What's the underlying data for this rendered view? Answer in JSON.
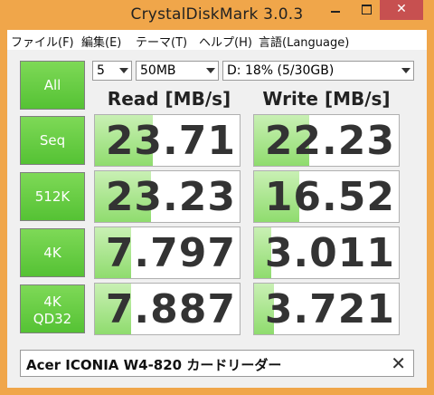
{
  "window": {
    "title": "CrystalDiskMark 3.0.3",
    "close_glyph": "✕"
  },
  "menu": [
    "ファイル(F)",
    "編集(E)",
    "テーマ(T)",
    "ヘルプ(H)",
    "言語(Language)"
  ],
  "controls": {
    "count": "5",
    "size": "50MB",
    "drive": "D: 18% (5/30GB)"
  },
  "headers": {
    "read": "Read [MB/s]",
    "write": "Write [MB/s]"
  },
  "buttons": {
    "all": "All",
    "seq": "Seq",
    "k512": "512K",
    "k4": "4K",
    "k4qd32_line1": "4K",
    "k4qd32_line2": "QD32"
  },
  "results": {
    "seq": {
      "read": "23.71",
      "write": "22.23",
      "read_bar": 0.4,
      "write_bar": 0.38
    },
    "k512": {
      "read": "23.23",
      "write": "16.52",
      "read_bar": 0.39,
      "write_bar": 0.31
    },
    "k4": {
      "read": "7.797",
      "write": "3.011",
      "read_bar": 0.25,
      "write_bar": 0.12
    },
    "k4qd32": {
      "read": "7.887",
      "write": "3.721",
      "read_bar": 0.25,
      "write_bar": 0.14
    }
  },
  "comment": {
    "text": "Acer ICONIA W4-820 カードリーダー",
    "clear_glyph": "✕"
  },
  "colors": {
    "title_bg": "#f0a64a",
    "button_green": "#55c234",
    "bar_green": "#8fdc6e",
    "close_red": "#c75050"
  }
}
